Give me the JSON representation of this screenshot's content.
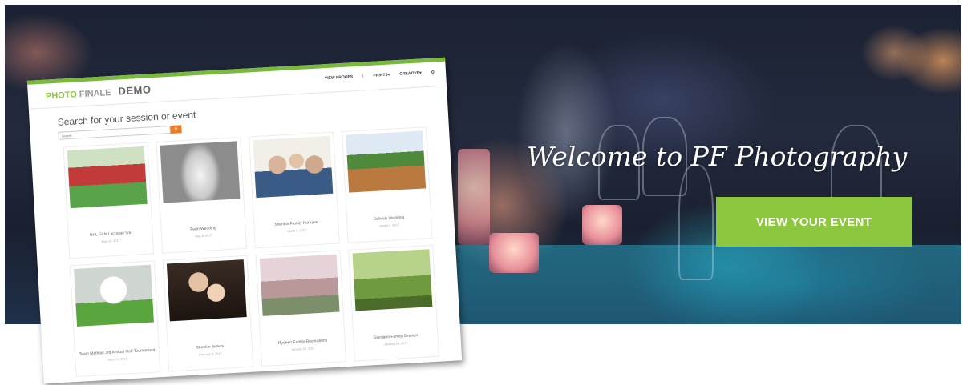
{
  "hero": {
    "title": "Welcome to PF Photography",
    "button_label": "VIEW YOUR EVENT",
    "button_color": "#8dc63f"
  },
  "screenshot": {
    "logo": {
      "part1": "PHOTO",
      "part2": "FINALE",
      "part3": "DEMO"
    },
    "nav": {
      "items": [
        "VIEW PROOFS",
        "PRINTS▾",
        "CREATIVE▾"
      ],
      "search_icon": "search-icon"
    },
    "search": {
      "heading": "Search for your session or event",
      "placeholder": "Search",
      "button_icon": "search-icon",
      "button_color": "#f47a20"
    },
    "galleries": [
      {
        "title": "NHL Girls Lacrosse 5/6",
        "date": "May 10, 2017"
      },
      {
        "title": "Fenn Wedding",
        "date": "May 8, 2017"
      },
      {
        "title": "Shenkin Family Portraits",
        "date": "March 3, 2017"
      },
      {
        "title": "Dolinski Wedding",
        "date": "March 2, 2017"
      },
      {
        "title": "Team Mathias 3rd Annual Golf Tournament",
        "date": "March 1, 2017"
      },
      {
        "title": "Shenkin Sisters",
        "date": "February 4, 2017"
      },
      {
        "title": "Rydeen Family Recreations",
        "date": "January 22, 2017"
      },
      {
        "title": "Giordano Family Session",
        "date": "January 20, 2017"
      }
    ]
  }
}
